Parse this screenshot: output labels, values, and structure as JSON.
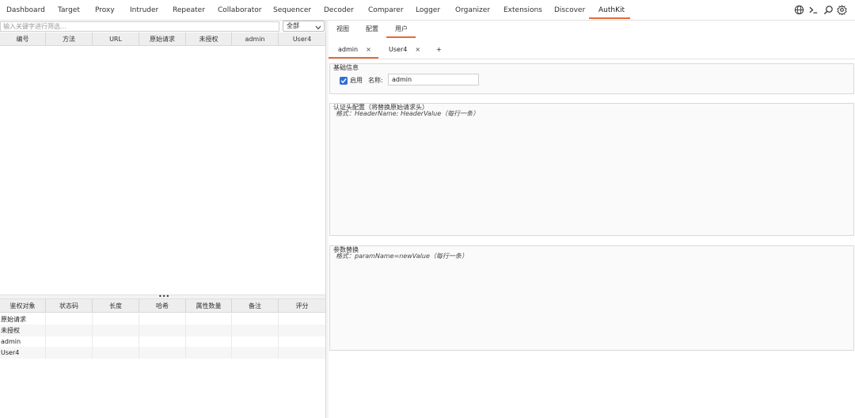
{
  "top_menu": {
    "items": [
      "Dashboard",
      "Target",
      "Proxy",
      "Intruder",
      "Repeater",
      "Collaborator",
      "Sequencer",
      "Decoder",
      "Comparer",
      "Logger",
      "Organizer",
      "Extensions",
      "Discover",
      "AuthKit"
    ],
    "active": "AuthKit",
    "icons": [
      "globe-icon",
      "terminal-icon",
      "search-icon",
      "gear-icon"
    ]
  },
  "left": {
    "filter_placeholder": "输入关键字进行筛选...",
    "filter_select": "全部",
    "request_table": {
      "columns": [
        "编号",
        "方法",
        "URL",
        "原始请求",
        "未授权",
        "admin",
        "User4"
      ]
    },
    "splitter_dots": "•••",
    "result_table": {
      "columns": [
        "鉴权对象",
        "状态码",
        "长度",
        "哈希",
        "属性数量",
        "备注",
        "评分"
      ],
      "rows": [
        "原始请求",
        "未授权",
        "admin",
        "User4"
      ]
    }
  },
  "right": {
    "subtabs": [
      "视图",
      "配置",
      "用户"
    ],
    "active_subtab": "用户",
    "user_tabs": [
      {
        "label": "admin",
        "close": "×"
      },
      {
        "label": "User4",
        "close": "×"
      }
    ],
    "add_tab": "+",
    "basic": {
      "title": "基础信息",
      "enabled_label": "启用",
      "enabled": true,
      "name_label": "名称:",
      "name_value": "admin"
    },
    "auth_header": {
      "title": "认证头配置（将替换原始请求头）",
      "hint": "格式：HeaderName: HeaderValue（每行一条）"
    },
    "param_replace": {
      "title": "参数替换",
      "hint": "格式：paramName=newValue（每行一条）"
    }
  },
  "colors": {
    "accent": "#e8693a",
    "checkbox": "#2f6fd6"
  }
}
